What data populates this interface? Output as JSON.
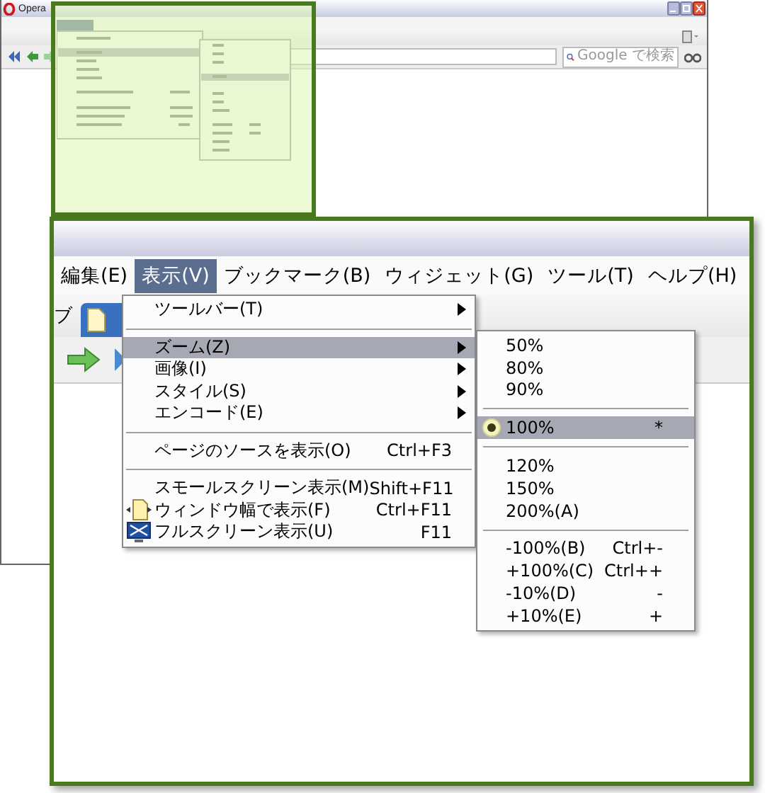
{
  "background_window": {
    "title": "Opera",
    "search_field": {
      "placeholder": "Google で検索"
    }
  },
  "inset": {
    "menu_bar": [
      {
        "label": "編集(E)",
        "selected": false
      },
      {
        "label": "表示(V)",
        "selected": true
      },
      {
        "label": "ブックマーク(B)",
        "selected": false
      },
      {
        "label": "ウィジェット(G)",
        "selected": false
      },
      {
        "label": "ツール(T)",
        "selected": false
      },
      {
        "label": "ヘルプ(H)",
        "selected": false
      }
    ],
    "tab_label": "ブ",
    "view_menu": [
      {
        "kind": "item",
        "label": "ツールバー(T)",
        "submenu": true,
        "highlighted": false
      },
      {
        "kind": "separator"
      },
      {
        "kind": "item",
        "label": "ズーム(Z)",
        "submenu": true,
        "highlighted": true
      },
      {
        "kind": "item",
        "label": "画像(I)",
        "submenu": true,
        "highlighted": false
      },
      {
        "kind": "item",
        "label": "スタイル(S)",
        "submenu": true,
        "highlighted": false
      },
      {
        "kind": "item",
        "label": "エンコード(E)",
        "submenu": true,
        "highlighted": false
      },
      {
        "kind": "separator"
      },
      {
        "kind": "item",
        "label": "ページのソースを表示(O)",
        "shortcut": "Ctrl+F3",
        "submenu": false,
        "highlighted": false
      },
      {
        "kind": "separator"
      },
      {
        "kind": "item",
        "label": "スモールスクリーン表示(M)",
        "shortcut": "Shift+F11",
        "submenu": false,
        "highlighted": false
      },
      {
        "kind": "fit-item",
        "label": "ウィンドウ幅で表示(F)",
        "shortcut": "Ctrl+F11",
        "submenu": false,
        "highlighted": false
      },
      {
        "kind": "screen-item",
        "label": "フルスクリーン表示(U)",
        "shortcut": "F11",
        "submenu": false,
        "highlighted": false
      }
    ],
    "zoom_menu": [
      {
        "kind": "option",
        "label": "50%",
        "selected": false,
        "highlighted": false
      },
      {
        "kind": "option",
        "label": "80%",
        "selected": false,
        "highlighted": false
      },
      {
        "kind": "option",
        "label": "90%",
        "selected": false,
        "highlighted": false
      },
      {
        "kind": "separator"
      },
      {
        "kind": "option",
        "label": "100%",
        "shortcut": "*",
        "selected": true,
        "highlighted": true
      },
      {
        "kind": "separator"
      },
      {
        "kind": "option",
        "label": "120%",
        "selected": false,
        "highlighted": false
      },
      {
        "kind": "option",
        "label": "150%",
        "selected": false,
        "highlighted": false
      },
      {
        "kind": "option",
        "label": "200%(A)",
        "selected": false,
        "highlighted": false
      },
      {
        "kind": "separator"
      },
      {
        "kind": "option",
        "label": "-100%(B)",
        "shortcut": "Ctrl+-",
        "selected": false,
        "highlighted": false
      },
      {
        "kind": "option",
        "label": "+100%(C)",
        "shortcut": "Ctrl++",
        "selected": false,
        "highlighted": false
      },
      {
        "kind": "option",
        "label": "-10%(D)",
        "shortcut": "-",
        "selected": false,
        "highlighted": false
      },
      {
        "kind": "option",
        "label": "+10%(E)",
        "shortcut": "+",
        "selected": false,
        "highlighted": false
      }
    ]
  }
}
